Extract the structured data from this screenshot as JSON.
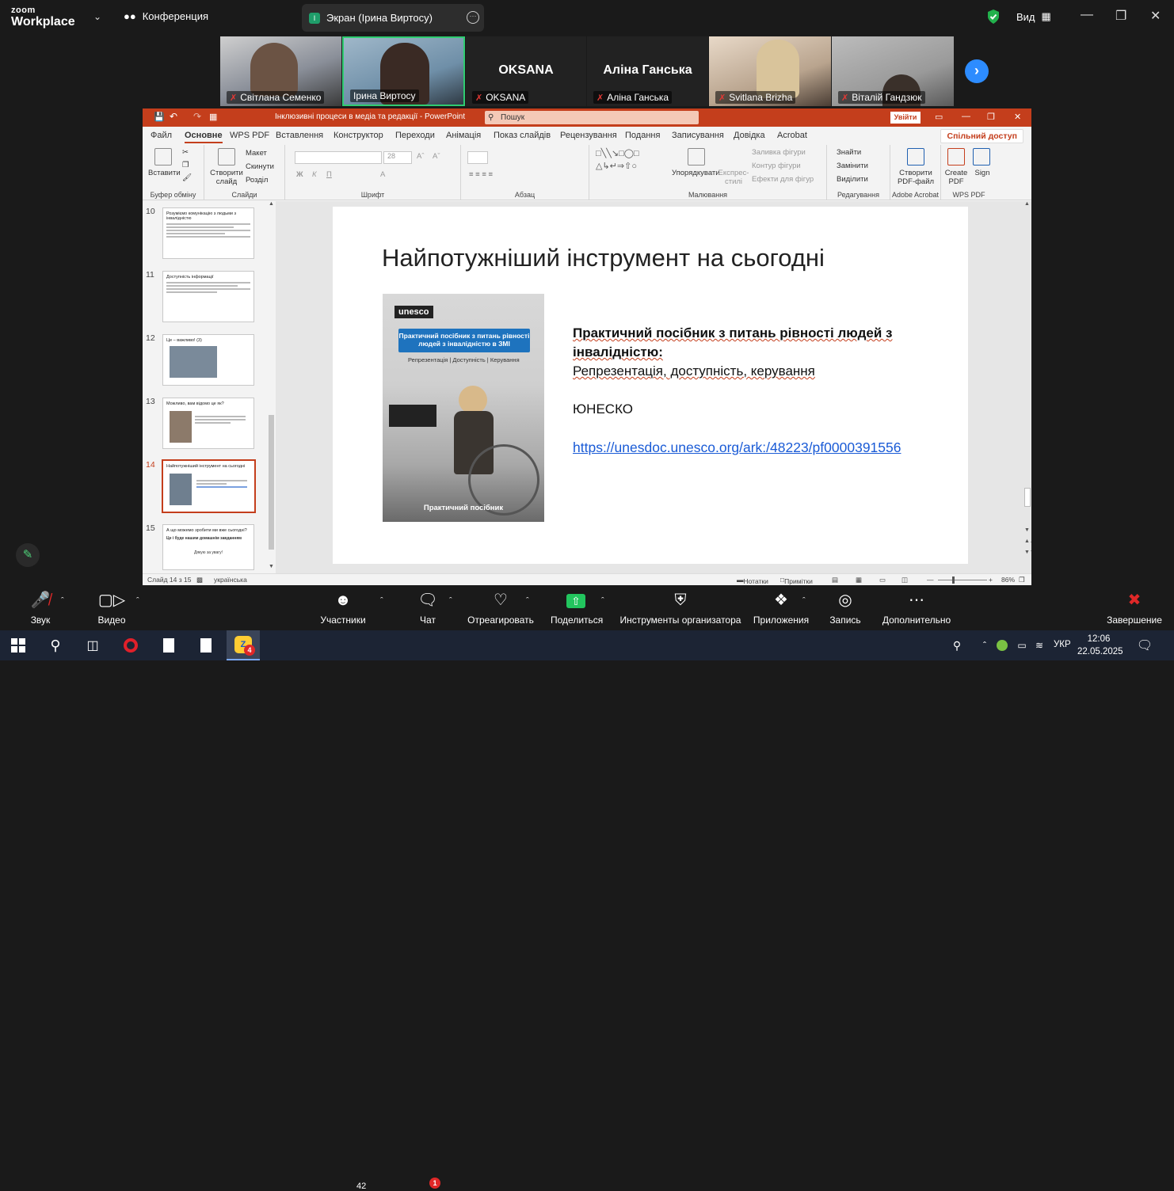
{
  "zoom": {
    "logo_line1": "zoom",
    "logo_line2": "Workplace",
    "meeting_label": "Конференция",
    "screen_share_label": "Экран (Ірина Виртосу)",
    "screen_share_avatar": "І",
    "view_label": "Вид",
    "participants_thumbs": [
      {
        "name": "Світлана Семенко",
        "muted": true,
        "video": true
      },
      {
        "name": "Ірина Виртосу",
        "muted": false,
        "video": true,
        "active_speaker": true
      },
      {
        "name": "OKSANA",
        "muted": true,
        "video": false,
        "display": "OKSANA"
      },
      {
        "name": "Аліна Ганська",
        "muted": true,
        "video": false,
        "display": "Аліна Ганська"
      },
      {
        "name": "Svitlana Brizha",
        "muted": true,
        "video": true
      },
      {
        "name": "Віталій Гандзюк",
        "muted": false,
        "video": true
      }
    ],
    "toolbar": {
      "audio": "Звук",
      "video": "Видео",
      "participants": "Участники",
      "participants_count": "42",
      "chat": "Чат",
      "chat_badge": "1",
      "react": "Отреагировать",
      "share": "Поделиться",
      "host_tools": "Инструменты организатора",
      "apps": "Приложения",
      "record": "Запись",
      "more": "Дополнительно",
      "end": "Завершение"
    }
  },
  "ppt": {
    "title": "Інклюзивні процеси в медіа та редакції  -  PowerPoint",
    "search_placeholder": "Пошук",
    "signin": "Увійти",
    "menu": [
      "Файл",
      "Основне",
      "WPS PDF",
      "Вставлення",
      "Конструктор",
      "Переходи",
      "Анімація",
      "Показ слайдів",
      "Рецензування",
      "Подання",
      "Записування",
      "Довідка",
      "Acrobat"
    ],
    "share": "Спільний доступ",
    "ribbon": {
      "paste": "Вставити",
      "clipboard": "Буфер обміну",
      "new_slide": "Створити слайд",
      "layout": "Макет",
      "reset": "Скинути",
      "section": "Розділ",
      "slides_group": "Слайди",
      "font_group": "Шрифт",
      "font_size": "28",
      "paragraph_group": "Абзац",
      "arrange": "Упорядкувати",
      "quick_styles": "Експрес-стилі",
      "shape_fill": "Заливка фігури",
      "shape_outline": "Контур фігури",
      "shape_effects": "Ефекти для фігур",
      "drawing_group": "Малювання",
      "find": "Знайти",
      "replace": "Замінити",
      "select": "Виділити",
      "editing_group": "Редагування",
      "create_pdf": "Створити PDF-файл",
      "acrobat_group": "Adobe Acrobat",
      "create_pdf_wps": "Create PDF",
      "sign": "Sign",
      "wps_group": "WPS PDF"
    },
    "thumbs": [
      {
        "num": "10",
        "title": "Розуміємо комунікацію з людьми з інвалідністю"
      },
      {
        "num": "11",
        "title": "Доступність інформації"
      },
      {
        "num": "12",
        "title": "Це – важливо! (3)"
      },
      {
        "num": "13",
        "title": "Можливо, вам відомо це як?"
      },
      {
        "num": "14",
        "title": "Найпотужніший інструмент на сьогодні"
      },
      {
        "num": "15",
        "title": "А що можемо зробити ми вже сьогодні?",
        "text1": "Це і буде нашим домашнім завданням",
        "text2": "Дякую за увагу!"
      }
    ],
    "slide": {
      "title": "Найпотужніший інструмент на сьогодні",
      "cover_logo": "unesco",
      "cover_heading": "Практичний посібник з питань рівності людей з інвалідністю в ЗМІ",
      "cover_sub": "Репрезентація | Доступність | Керування",
      "cover_footer": "Практичний посібник",
      "line1_bold": "Практичний посібник з питань рівності людей з інвалідністю:",
      "line2": "Репрезентація, доступність, керування",
      "org": "ЮНЕСКО",
      "link": "https://unesdoc.unesco.org/ark:/48223/pf0000391556"
    },
    "status": {
      "slide_of": "Слайд 14 з 15",
      "language": "українська",
      "notes": "Нотатки",
      "comments": "Примітки",
      "zoom": "86%"
    }
  },
  "taskbar": {
    "lang": "УКР",
    "time": "12:06",
    "date": "22.05.2025",
    "zoom_badge": "4"
  }
}
